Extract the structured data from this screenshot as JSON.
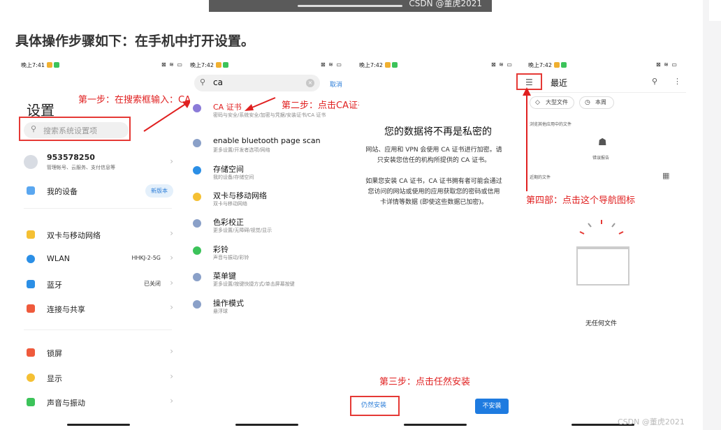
{
  "watermark_top": "CSDN @董虎2021",
  "heading": "具体操作步骤如下：在手机中打开设置。",
  "annotations": {
    "step1": "第一步：在搜索框输入：CA",
    "step2": "第二步：点击CA证书",
    "step3": "第三步：点击任然安装",
    "step4": "第四部：点击这个导航图标"
  },
  "screen1": {
    "time": "晚上7:41",
    "status_right": "⊠ ≋ ▭",
    "title": "设置",
    "search_placeholder": "搜索系统设置项",
    "account": {
      "name": "953578250",
      "sub": "管理帐号、云服务、支付信息等"
    },
    "my_device": {
      "label": "我的设备",
      "badge": "新版本"
    },
    "items": [
      {
        "label": "双卡与移动网络",
        "value": "",
        "color": "#f5c033"
      },
      {
        "label": "WLAN",
        "value": "HHKJ-2-5G",
        "color": "#2b8fe6"
      },
      {
        "label": "蓝牙",
        "value": "已关闭",
        "color": "#2b8fe6"
      },
      {
        "label": "连接与共享",
        "value": "",
        "color": "#ef5a3c"
      },
      {
        "label": "锁屏",
        "value": "",
        "color": "#ef5a3c"
      },
      {
        "label": "显示",
        "value": "",
        "color": "#f5c033"
      },
      {
        "label": "声音与振动",
        "value": "",
        "color": "#3cc35a"
      }
    ]
  },
  "screen2": {
    "time": "晚上7:42",
    "status_right": "⊠ ≋ ▭",
    "search_value": "ca",
    "cancel": "取消",
    "results": [
      {
        "title": "CA 证书",
        "sub": "密码与安全/系统安全/加密与凭据/安装证书/CA 证书",
        "color": "#8b7bd8"
      },
      {
        "title": "enable bluetooth page scan",
        "sub": "更多设置/开发者选项/网络",
        "color": "#8aa0c8"
      },
      {
        "title": "存储空间",
        "sub": "我的设备/存储空间",
        "color": "#2b8fe6"
      },
      {
        "title": "双卡与移动网络",
        "sub": "双卡与移动网络",
        "color": "#f5c033"
      },
      {
        "title": "色彩校正",
        "sub": "更多设置/无障碍/视觉/显示",
        "color": "#8aa0c8"
      },
      {
        "title": "彩铃",
        "sub": "声音与振动/彩铃",
        "color": "#3cc35a"
      },
      {
        "title": "菜单键",
        "sub": "更多设置/按键快捷方式/单击屏幕按键",
        "color": "#8aa0c8"
      },
      {
        "title": "操作模式",
        "sub": "悬浮球",
        "color": "#8aa0c8"
      }
    ]
  },
  "screen3": {
    "time": "晚上7:42",
    "status_right": "⊠ ≋ ▭",
    "heading": "您的数据将不再是私密的",
    "p1a": "网站、应用和 VPN 会使用 CA 证书进行加密。请",
    "p1b": "只安装您信任的机构所提供的 CA 证书。",
    "p2a": "如果您安装 CA 证书，CA 证书拥有者可能会通过",
    "p2b": "您访问的网站或使用的应用获取您的密码或信用",
    "p2c": "卡详情等数据 (即使这些数据已加密)。",
    "install_anyway": "仍然安装",
    "dont_install": "不安装"
  },
  "screen4": {
    "time": "晚上7:42",
    "status_right": "⊠ ≋ ▭",
    "title": "最近",
    "chip1": "大型文件",
    "chip2": "本周",
    "section1": "浏览其他应用中的文件",
    "bug_report": "错误报告",
    "section2": "近期的文件",
    "empty": "无任何文件"
  },
  "watermark_bottom": "CSDN @董虎2021"
}
